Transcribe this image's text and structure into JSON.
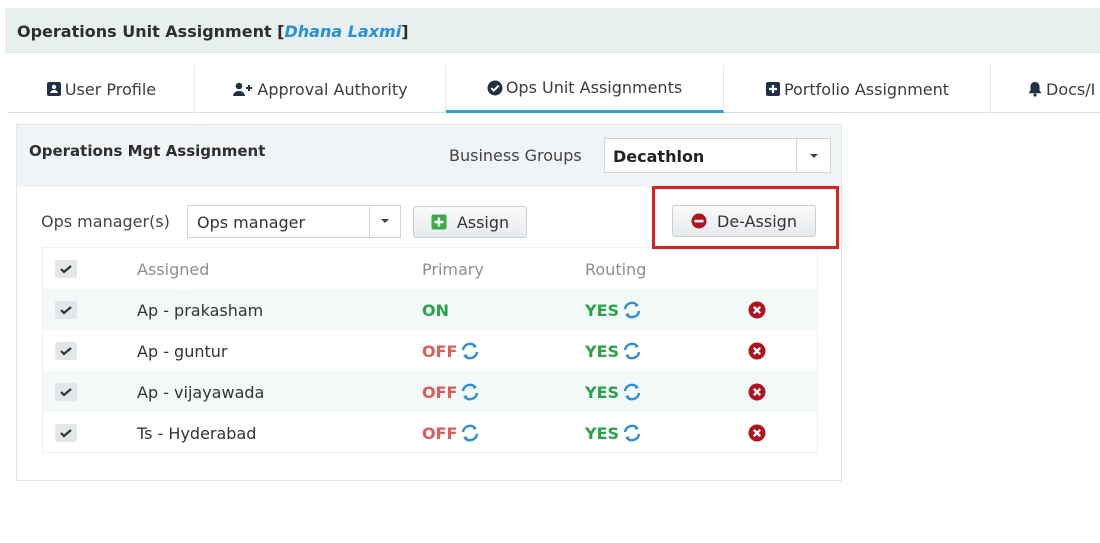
{
  "header": {
    "title_prefix": "Operations Unit Assignment [",
    "user": "Dhana Laxmi",
    "title_suffix": "]"
  },
  "tabs": [
    {
      "label": "User Profile",
      "icon": "id-card-icon"
    },
    {
      "label": "Approval Authority",
      "icon": "user-plus-icon"
    },
    {
      "label": "Ops Unit Assignments",
      "icon": "check-circle-icon",
      "active": true
    },
    {
      "label": "Portfolio Assignment",
      "icon": "plus-square-icon"
    },
    {
      "label": "Docs/I",
      "icon": "bell-icon"
    }
  ],
  "panel": {
    "title": "Operations Mgt Assignment",
    "business_groups_label": "Business Groups",
    "business_group_value": "Decathlon",
    "ops_manager_label": "Ops manager(s)",
    "ops_manager_value": "Ops manager",
    "assign_label": "Assign",
    "deassign_label": "De-Assign"
  },
  "table": {
    "headers": {
      "assigned": "Assigned",
      "primary": "Primary",
      "routing": "Routing"
    },
    "rows": [
      {
        "assigned": "Ap - prakasham",
        "primary": "ON",
        "routing": "YES"
      },
      {
        "assigned": "Ap - guntur",
        "primary": "OFF",
        "routing": "YES"
      },
      {
        "assigned": "Ap - vijayawada",
        "primary": "OFF",
        "routing": "YES"
      },
      {
        "assigned": "Ts - Hyderabad",
        "primary": "OFF",
        "routing": "YES"
      }
    ]
  },
  "colors": {
    "accent": "#29a3e0",
    "on": "#2aa24a",
    "off": "#e05a5a",
    "highlight": "#e51d1d",
    "delete": "#b0151f"
  }
}
